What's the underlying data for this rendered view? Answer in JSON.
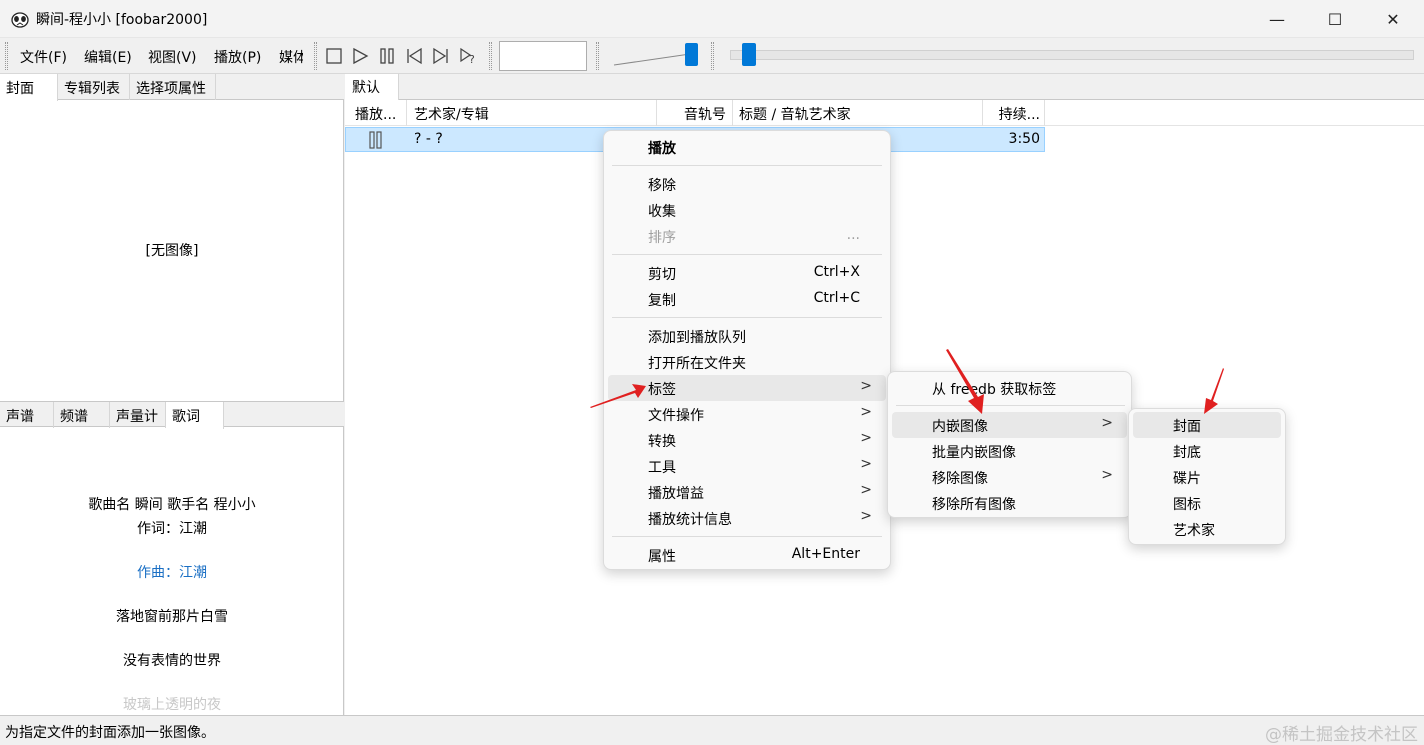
{
  "window": {
    "title": "瞬间-程小小  [foobar2000]",
    "minimize": "—",
    "maximize": "☐",
    "close": "✕"
  },
  "menubar": [
    "文件(F)",
    "编辑(E)",
    "视图(V)",
    "播放(P)",
    "媒体"
  ],
  "playback": {
    "seek_position_fraction": 0.02,
    "volume_fraction": 0.85
  },
  "left_top_tabs": [
    "封面",
    "专辑列表",
    "选择项属性"
  ],
  "cover": {
    "placeholder": "[无图像]"
  },
  "left_bottom_tabs": [
    "声谱",
    "频谱",
    "声量计",
    "歌词"
  ],
  "lyrics": [
    {
      "text": "歌曲名 瞬间 歌手名 程小小",
      "state": "normal"
    },
    {
      "text": "作词：江潮",
      "state": "normal"
    },
    {
      "text": "作曲：江潮",
      "state": "current"
    },
    {
      "text": "落地窗前那片白雪",
      "state": "normal"
    },
    {
      "text": "没有表情的世界",
      "state": "normal"
    },
    {
      "text": "玻璃上透明的夜",
      "state": "faded"
    }
  ],
  "playlist": {
    "tab": "默认",
    "columns": [
      "播放...",
      "艺术家/专辑",
      "音轨号",
      "标题 / 音轨艺术家",
      "持续..."
    ],
    "rows": [
      {
        "playing_icon": "pause-icon",
        "artist_album": "? - ?",
        "track": "",
        "title": "",
        "duration": "3:50"
      }
    ]
  },
  "context_menu": {
    "items": [
      {
        "label": "播放",
        "bold": true
      },
      {
        "separator": true
      },
      {
        "label": "移除"
      },
      {
        "label": "收集"
      },
      {
        "label": "排序",
        "shortcut": "...",
        "disabled": true
      },
      {
        "separator": true
      },
      {
        "label": "剪切",
        "shortcut": "Ctrl+X"
      },
      {
        "label": "复制",
        "shortcut": "Ctrl+C"
      },
      {
        "separator": true
      },
      {
        "label": "添加到播放队列"
      },
      {
        "label": "打开所在文件夹"
      },
      {
        "label": "标签",
        "submenu": true,
        "highlighted": true
      },
      {
        "label": "文件操作",
        "submenu": true
      },
      {
        "label": "转换",
        "submenu": true
      },
      {
        "label": "工具",
        "submenu": true
      },
      {
        "label": "播放增益",
        "submenu": true
      },
      {
        "label": "播放统计信息",
        "submenu": true
      },
      {
        "separator": true
      },
      {
        "label": "属性",
        "shortcut": "Alt+Enter"
      }
    ]
  },
  "tag_submenu": {
    "items": [
      {
        "label": "从 freedb 获取标签"
      },
      {
        "separator": true
      },
      {
        "label": "内嵌图像",
        "submenu": true,
        "highlighted": true
      },
      {
        "label": "批量内嵌图像"
      },
      {
        "label": "移除图像",
        "submenu": true
      },
      {
        "label": "移除所有图像"
      }
    ]
  },
  "embed_submenu": {
    "items": [
      {
        "label": "封面",
        "highlighted": true
      },
      {
        "label": "封底"
      },
      {
        "label": "碟片"
      },
      {
        "label": "图标"
      },
      {
        "label": "艺术家"
      }
    ]
  },
  "status": {
    "text": "为指定文件的封面添加一张图像。"
  },
  "watermark": "@稀土掘金技术社区",
  "colors": {
    "accent": "#0078d7",
    "selection": "#cce8ff",
    "current_lyric": "#1a6fc4",
    "arrow": "#e02020"
  }
}
